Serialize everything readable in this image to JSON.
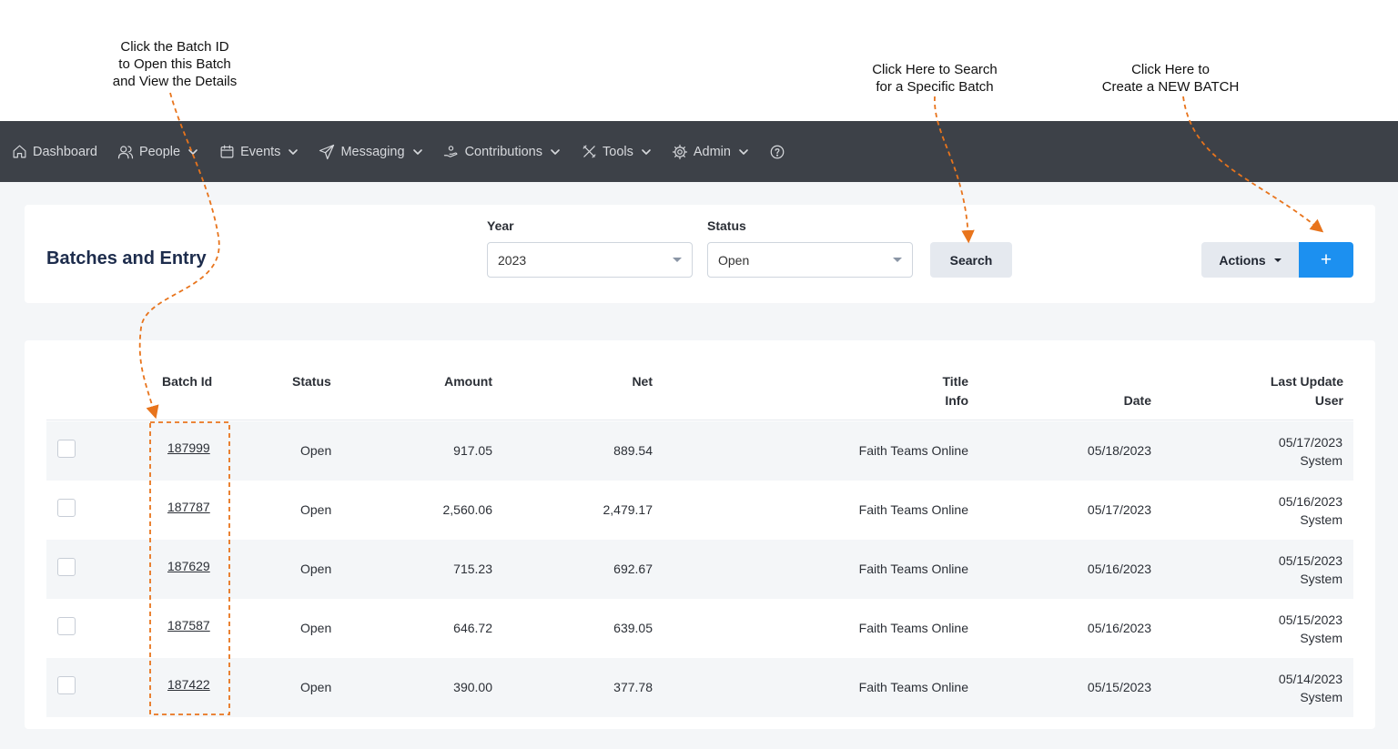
{
  "annotations": {
    "batch_id": [
      "Click the Batch ID",
      "to Open this Batch",
      "and View the Details"
    ],
    "search": [
      "Click Here to Search",
      "for a Specific Batch"
    ],
    "new_batch": [
      "Click Here to",
      "Create a NEW BATCH"
    ]
  },
  "nav": [
    {
      "label": "Dashboard",
      "icon": "home-icon",
      "chevron": false
    },
    {
      "label": "People",
      "icon": "people-icon",
      "chevron": true
    },
    {
      "label": "Events",
      "icon": "calendar-icon",
      "chevron": true
    },
    {
      "label": "Messaging",
      "icon": "paper-plane-icon",
      "chevron": true
    },
    {
      "label": "Contributions",
      "icon": "hand-donation-icon",
      "chevron": true
    },
    {
      "label": "Tools",
      "icon": "tools-icon",
      "chevron": true
    },
    {
      "label": "Admin",
      "icon": "gear-icon",
      "chevron": true
    }
  ],
  "help_icon": "help-circle-icon",
  "page_title": "Batches and Entry",
  "filters": {
    "year_label": "Year",
    "year_value": "2023",
    "status_label": "Status",
    "status_value": "Open",
    "search_label": "Search"
  },
  "actions_label": "Actions",
  "add_label": "+",
  "table": {
    "headers": {
      "batch_id": "Batch Id",
      "status": "Status",
      "amount": "Amount",
      "net": "Net",
      "title_1": "Title",
      "title_2": "Info",
      "date": "Date",
      "last_1": "Last Update",
      "last_2": "User"
    },
    "rows": [
      {
        "batch_id": "187999",
        "status": "Open",
        "amount": "917.05",
        "net": "889.54",
        "title": "Faith Teams Online",
        "date": "05/18/2023",
        "last_update": "05/17/2023",
        "user": "System"
      },
      {
        "batch_id": "187787",
        "status": "Open",
        "amount": "2,560.06",
        "net": "2,479.17",
        "title": "Faith Teams Online",
        "date": "05/17/2023",
        "last_update": "05/16/2023",
        "user": "System"
      },
      {
        "batch_id": "187629",
        "status": "Open",
        "amount": "715.23",
        "net": "692.67",
        "title": "Faith Teams Online",
        "date": "05/16/2023",
        "last_update": "05/15/2023",
        "user": "System"
      },
      {
        "batch_id": "187587",
        "status": "Open",
        "amount": "646.72",
        "net": "639.05",
        "title": "Faith Teams Online",
        "date": "05/16/2023",
        "last_update": "05/15/2023",
        "user": "System"
      },
      {
        "batch_id": "187422",
        "status": "Open",
        "amount": "390.00",
        "net": "377.78",
        "title": "Faith Teams Online",
        "date": "05/15/2023",
        "last_update": "05/14/2023",
        "user": "System"
      }
    ]
  },
  "colors": {
    "nav_bg": "#3d4148",
    "page_bg": "#f4f6f8",
    "accent": "#1c90f0",
    "annotation": "#e8741c",
    "title": "#1d2c4c"
  }
}
